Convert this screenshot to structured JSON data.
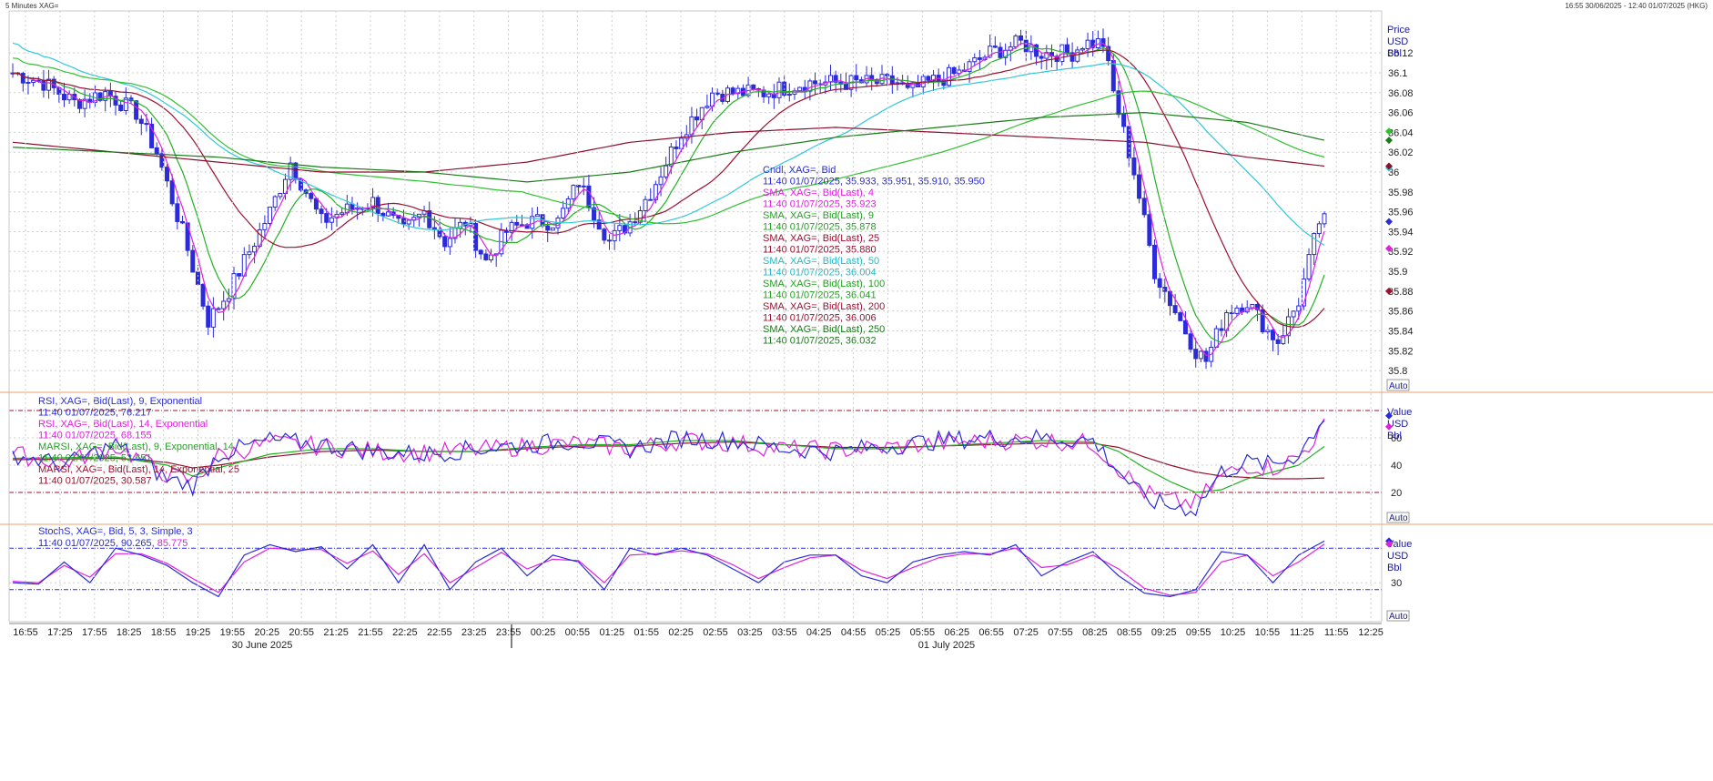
{
  "window": {
    "title": "5 Minutes XAG=",
    "time_range": "16:55 30/06/2025 - 12:40 01/07/2025 (HKG)"
  },
  "colors": {
    "candle": "#2b2bd9",
    "sma4": "#e020e0",
    "sma9": "#22b022",
    "sma25": "#9c1030",
    "sma50": "#30c8d8",
    "sma100": "#30c030",
    "sma200": "#8a1030",
    "sma250": "#1a7a1a",
    "rsi9": "#2a2ad8",
    "rsi14": "#e020e0",
    "marsi9": "#22b022",
    "marsi14": "#9c1030",
    "stoch_k": "#2a2ad8",
    "stoch_d": "#e020e0",
    "grid": "#cfcfcf",
    "divider": "#e8a070"
  },
  "price_panel": {
    "axis_header": [
      "Price",
      "USD",
      "Bbl"
    ],
    "auto_label": "Auto",
    "legend": [
      {
        "label": "Cndl, XAG=, Bid",
        "value": "11:40 01/07/2025, 35.933, 35.951, 35.910, 35.950",
        "color": "#2a2ad8"
      },
      {
        "label": "SMA, XAG=, Bid(Last),  4",
        "value": "11:40 01/07/2025, 35.923",
        "color": "#e020e0"
      },
      {
        "label": "SMA, XAG=, Bid(Last),  9",
        "value": "11:40 01/07/2025, 35.878",
        "color": "#22a022"
      },
      {
        "label": "SMA, XAG=, Bid(Last),  25",
        "value": "11:40 01/07/2025, 35.880",
        "color": "#9c1030"
      },
      {
        "label": "SMA, XAG=, Bid(Last),  50",
        "value": "11:40 01/07/2025, 36.004",
        "color": "#22b8c8"
      },
      {
        "label": "SMA, XAG=, Bid(Last),  100",
        "value": "11:40 01/07/2025, 36.041",
        "color": "#22a022"
      },
      {
        "label": "SMA, XAG=, Bid(Last),  200",
        "value": "11:40 01/07/2025, 36.006",
        "color": "#9c1030"
      },
      {
        "label": "SMA, XAG=, Bid(Last),  250",
        "value": "11:40 01/07/2025, 36.032",
        "color": "#1a7a1a"
      }
    ]
  },
  "rsi_panel": {
    "axis_header": [
      "Value",
      "USD",
      "Bbl"
    ],
    "auto_label": "Auto",
    "legend": [
      {
        "label": "RSI, XAG=, Bid(Last),  9, Exponential",
        "value": "11:40 01/07/2025, 76.217",
        "color": "#2a2ad8"
      },
      {
        "label": "RSI, XAG=, Bid(Last),  14, Exponential",
        "value": "11:40 01/07/2025, 68.155",
        "color": "#e020e0"
      },
      {
        "label": "MARSI, XAG=, Bid(Last),  9, Exponential, 14",
        "value": "11:40 01/07/2025, 53.651",
        "color": "#22a022"
      },
      {
        "label": "MARSI, XAG=, Bid(Last),  14, Exponential, 25",
        "value": "11:40 01/07/2025, 30.587",
        "color": "#9c1030"
      }
    ]
  },
  "stoch_panel": {
    "axis_header": [
      "Value",
      "USD",
      "Bbl"
    ],
    "auto_label": "Auto",
    "legend_label": "StochS, XAG=, Bid,  5, 3, Simple, 3",
    "legend_time": "11:40 01/07/2025, ",
    "legend_k": "90.265",
    "legend_sep": ", ",
    "legend_d": "85.775"
  },
  "x_axis": {
    "date_labels": [
      "30 June 2025",
      "01 July 2025"
    ]
  },
  "chart_data": {
    "type": "line",
    "title": "5 Minutes XAG=",
    "x_tick_labels": [
      "16:55",
      "17:25",
      "17:55",
      "18:25",
      "18:55",
      "19:25",
      "19:55",
      "20:25",
      "20:55",
      "21:25",
      "21:55",
      "22:25",
      "22:55",
      "23:25",
      "23:55",
      "00:25",
      "00:55",
      "01:25",
      "01:55",
      "02:25",
      "02:55",
      "03:25",
      "03:55",
      "04:25",
      "04:55",
      "05:25",
      "05:55",
      "06:25",
      "06:55",
      "07:25",
      "07:55",
      "08:25",
      "08:55",
      "09:25",
      "09:55",
      "10:25",
      "10:55",
      "11:25",
      "11:55",
      "12:25"
    ],
    "price_ticks": [
      "36.12",
      "36.1",
      "36.08",
      "36.06",
      "36.04",
      "36.02",
      "36",
      "35.98",
      "35.96",
      "35.94",
      "35.92",
      "35.9",
      "35.88",
      "35.86",
      "35.84",
      "35.82",
      "35.8"
    ],
    "rsi_ticks": [
      "60",
      "40",
      "20"
    ],
    "stoch_ticks": [
      "30"
    ],
    "price_ylim": [
      35.79,
      36.155
    ],
    "rsi_ylim": [
      0,
      90
    ],
    "rsi_levels": [
      80,
      20
    ],
    "stoch_ylim": [
      0,
      100
    ],
    "stoch_levels": [
      80,
      20
    ],
    "price_close_anchors": [
      [
        0,
        36.1
      ],
      [
        6,
        36.09
      ],
      [
        12,
        36.07
      ],
      [
        18,
        36.08
      ],
      [
        24,
        36.06
      ],
      [
        28,
        36.02
      ],
      [
        33,
        35.94
      ],
      [
        38,
        35.85
      ],
      [
        42,
        35.88
      ],
      [
        46,
        35.92
      ],
      [
        50,
        35.96
      ],
      [
        54,
        36.01
      ],
      [
        56,
        35.99
      ],
      [
        60,
        35.95
      ],
      [
        64,
        35.96
      ],
      [
        70,
        35.97
      ],
      [
        76,
        35.94
      ],
      [
        80,
        35.96
      ],
      [
        84,
        35.93
      ],
      [
        88,
        35.95
      ],
      [
        92,
        35.91
      ],
      [
        96,
        35.94
      ],
      [
        100,
        35.95
      ],
      [
        106,
        35.95
      ],
      [
        110,
        35.99
      ],
      [
        114,
        35.95
      ],
      [
        116,
        35.93
      ],
      [
        120,
        35.95
      ],
      [
        124,
        35.98
      ],
      [
        130,
        36.04
      ],
      [
        136,
        36.08
      ],
      [
        140,
        36.08
      ],
      [
        146,
        36.08
      ],
      [
        154,
        36.09
      ],
      [
        160,
        36.09
      ],
      [
        166,
        36.09
      ],
      [
        172,
        36.09
      ],
      [
        174,
        36.08
      ],
      [
        178,
        36.09
      ],
      [
        184,
        36.1
      ],
      [
        190,
        36.12
      ],
      [
        196,
        36.13
      ],
      [
        200,
        36.12
      ],
      [
        206,
        36.12
      ],
      [
        208,
        36.13
      ],
      [
        212,
        36.13
      ],
      [
        214,
        36.08
      ],
      [
        218,
        36.0
      ],
      [
        222,
        35.9
      ],
      [
        226,
        35.86
      ],
      [
        230,
        35.82
      ],
      [
        232,
        35.81
      ],
      [
        236,
        35.86
      ],
      [
        240,
        35.87
      ],
      [
        244,
        35.84
      ],
      [
        246,
        35.83
      ],
      [
        250,
        35.87
      ],
      [
        254,
        35.95
      ]
    ],
    "sma200_anchors": [
      [
        0,
        36.03
      ],
      [
        20,
        36.02
      ],
      [
        40,
        36.01
      ],
      [
        60,
        36.0
      ],
      [
        80,
        36.0
      ],
      [
        100,
        36.01
      ],
      [
        120,
        36.03
      ],
      [
        140,
        36.04
      ],
      [
        160,
        36.045
      ],
      [
        180,
        36.04
      ],
      [
        200,
        36.035
      ],
      [
        220,
        36.03
      ],
      [
        240,
        36.015
      ],
      [
        255,
        36.006
      ]
    ],
    "sma250_anchors": [
      [
        0,
        36.025
      ],
      [
        20,
        36.02
      ],
      [
        40,
        36.015
      ],
      [
        60,
        36.005
      ],
      [
        80,
        36.0
      ],
      [
        100,
        35.99
      ],
      [
        120,
        36.0
      ],
      [
        140,
        36.02
      ],
      [
        160,
        36.035
      ],
      [
        180,
        36.045
      ],
      [
        200,
        36.055
      ],
      [
        220,
        36.06
      ],
      [
        240,
        36.05
      ],
      [
        255,
        36.032
      ]
    ],
    "rsi9_anchors": [
      [
        0,
        48
      ],
      [
        10,
        40
      ],
      [
        20,
        55
      ],
      [
        30,
        30
      ],
      [
        35,
        25
      ],
      [
        40,
        48
      ],
      [
        50,
        58
      ],
      [
        60,
        55
      ],
      [
        70,
        50
      ],
      [
        80,
        48
      ],
      [
        90,
        52
      ],
      [
        100,
        55
      ],
      [
        110,
        58
      ],
      [
        120,
        52
      ],
      [
        130,
        60
      ],
      [
        140,
        58
      ],
      [
        150,
        52
      ],
      [
        160,
        50
      ],
      [
        170,
        54
      ],
      [
        180,
        58
      ],
      [
        190,
        60
      ],
      [
        200,
        60
      ],
      [
        210,
        58
      ],
      [
        215,
        36
      ],
      [
        220,
        15
      ],
      [
        225,
        10
      ],
      [
        230,
        8
      ],
      [
        235,
        35
      ],
      [
        240,
        42
      ],
      [
        245,
        40
      ],
      [
        250,
        48
      ],
      [
        255,
        76
      ]
    ],
    "rsi14_anchors": [
      [
        0,
        48
      ],
      [
        10,
        42
      ],
      [
        20,
        54
      ],
      [
        30,
        33
      ],
      [
        35,
        28
      ],
      [
        40,
        47
      ],
      [
        50,
        56
      ],
      [
        60,
        54
      ],
      [
        70,
        50
      ],
      [
        80,
        49
      ],
      [
        90,
        51
      ],
      [
        100,
        54
      ],
      [
        110,
        56
      ],
      [
        120,
        52
      ],
      [
        130,
        58
      ],
      [
        140,
        56
      ],
      [
        150,
        52
      ],
      [
        160,
        51
      ],
      [
        170,
        53
      ],
      [
        180,
        56
      ],
      [
        190,
        58
      ],
      [
        200,
        58
      ],
      [
        210,
        56
      ],
      [
        215,
        38
      ],
      [
        220,
        20
      ],
      [
        225,
        14
      ],
      [
        230,
        12
      ],
      [
        235,
        32
      ],
      [
        240,
        40
      ],
      [
        245,
        38
      ],
      [
        250,
        46
      ],
      [
        255,
        68
      ]
    ],
    "marsi9_anchors": [
      [
        0,
        45
      ],
      [
        20,
        46
      ],
      [
        30,
        40
      ],
      [
        35,
        32
      ],
      [
        40,
        38
      ],
      [
        50,
        48
      ],
      [
        60,
        52
      ],
      [
        70,
        52
      ],
      [
        80,
        50
      ],
      [
        90,
        50
      ],
      [
        100,
        53
      ],
      [
        110,
        55
      ],
      [
        120,
        55
      ],
      [
        130,
        58
      ],
      [
        140,
        58
      ],
      [
        150,
        55
      ],
      [
        160,
        52
      ],
      [
        170,
        52
      ],
      [
        180,
        54
      ],
      [
        190,
        56
      ],
      [
        200,
        58
      ],
      [
        210,
        57
      ],
      [
        215,
        50
      ],
      [
        220,
        38
      ],
      [
        225,
        28
      ],
      [
        230,
        20
      ],
      [
        235,
        22
      ],
      [
        240,
        30
      ],
      [
        245,
        35
      ],
      [
        250,
        40
      ],
      [
        255,
        53.65
      ]
    ],
    "marsi14_anchors": [
      [
        0,
        44
      ],
      [
        20,
        45
      ],
      [
        30,
        42
      ],
      [
        35,
        38
      ],
      [
        40,
        40
      ],
      [
        50,
        46
      ],
      [
        60,
        50
      ],
      [
        70,
        51
      ],
      [
        80,
        50
      ],
      [
        90,
        50
      ],
      [
        100,
        52
      ],
      [
        110,
        54
      ],
      [
        120,
        54
      ],
      [
        130,
        56
      ],
      [
        140,
        57
      ],
      [
        150,
        55
      ],
      [
        160,
        53
      ],
      [
        170,
        53
      ],
      [
        180,
        54
      ],
      [
        190,
        55
      ],
      [
        200,
        56
      ],
      [
        210,
        56
      ],
      [
        215,
        53
      ],
      [
        220,
        46
      ],
      [
        225,
        40
      ],
      [
        230,
        35
      ],
      [
        235,
        32
      ],
      [
        240,
        31
      ],
      [
        245,
        30
      ],
      [
        250,
        30
      ],
      [
        255,
        30.59
      ]
    ],
    "stoch_k_anchors": [
      [
        0,
        30
      ],
      [
        5,
        28
      ],
      [
        10,
        60
      ],
      [
        15,
        30
      ],
      [
        20,
        80
      ],
      [
        25,
        70
      ],
      [
        30,
        55
      ],
      [
        35,
        30
      ],
      [
        40,
        10
      ],
      [
        45,
        70
      ],
      [
        50,
        85
      ],
      [
        55,
        75
      ],
      [
        60,
        82
      ],
      [
        65,
        50
      ],
      [
        70,
        85
      ],
      [
        75,
        30
      ],
      [
        80,
        85
      ],
      [
        85,
        20
      ],
      [
        90,
        60
      ],
      [
        95,
        80
      ],
      [
        100,
        40
      ],
      [
        105,
        70
      ],
      [
        110,
        60
      ],
      [
        115,
        20
      ],
      [
        120,
        80
      ],
      [
        125,
        70
      ],
      [
        130,
        80
      ],
      [
        135,
        70
      ],
      [
        140,
        50
      ],
      [
        145,
        30
      ],
      [
        150,
        60
      ],
      [
        155,
        70
      ],
      [
        160,
        70
      ],
      [
        165,
        40
      ],
      [
        170,
        30
      ],
      [
        175,
        60
      ],
      [
        180,
        70
      ],
      [
        185,
        75
      ],
      [
        190,
        70
      ],
      [
        195,
        85
      ],
      [
        200,
        40
      ],
      [
        205,
        60
      ],
      [
        210,
        75
      ],
      [
        215,
        40
      ],
      [
        220,
        15
      ],
      [
        225,
        10
      ],
      [
        230,
        20
      ],
      [
        235,
        75
      ],
      [
        240,
        70
      ],
      [
        245,
        30
      ],
      [
        250,
        70
      ],
      [
        255,
        90.3
      ]
    ],
    "stoch_d_anchors": [
      [
        0,
        32
      ],
      [
        5,
        30
      ],
      [
        10,
        55
      ],
      [
        15,
        38
      ],
      [
        20,
        72
      ],
      [
        25,
        72
      ],
      [
        30,
        58
      ],
      [
        35,
        36
      ],
      [
        40,
        16
      ],
      [
        45,
        60
      ],
      [
        50,
        80
      ],
      [
        55,
        78
      ],
      [
        60,
        78
      ],
      [
        65,
        58
      ],
      [
        70,
        76
      ],
      [
        75,
        42
      ],
      [
        80,
        72
      ],
      [
        85,
        30
      ],
      [
        90,
        52
      ],
      [
        95,
        74
      ],
      [
        100,
        50
      ],
      [
        105,
        64
      ],
      [
        110,
        62
      ],
      [
        115,
        30
      ],
      [
        120,
        70
      ],
      [
        125,
        72
      ],
      [
        130,
        76
      ],
      [
        135,
        72
      ],
      [
        140,
        56
      ],
      [
        145,
        36
      ],
      [
        150,
        52
      ],
      [
        155,
        66
      ],
      [
        160,
        70
      ],
      [
        165,
        48
      ],
      [
        170,
        36
      ],
      [
        175,
        52
      ],
      [
        180,
        66
      ],
      [
        185,
        72
      ],
      [
        190,
        72
      ],
      [
        195,
        80
      ],
      [
        200,
        52
      ],
      [
        205,
        56
      ],
      [
        210,
        70
      ],
      [
        215,
        50
      ],
      [
        220,
        22
      ],
      [
        225,
        12
      ],
      [
        230,
        16
      ],
      [
        235,
        60
      ],
      [
        240,
        70
      ],
      [
        245,
        40
      ],
      [
        250,
        60
      ],
      [
        255,
        85.8
      ]
    ],
    "last_values": {
      "sma4": 35.923,
      "sma9": 35.878,
      "sma25": 35.88,
      "sma50": 36.004,
      "sma100": 36.041,
      "sma200": 36.006,
      "sma250": 36.032
    }
  }
}
